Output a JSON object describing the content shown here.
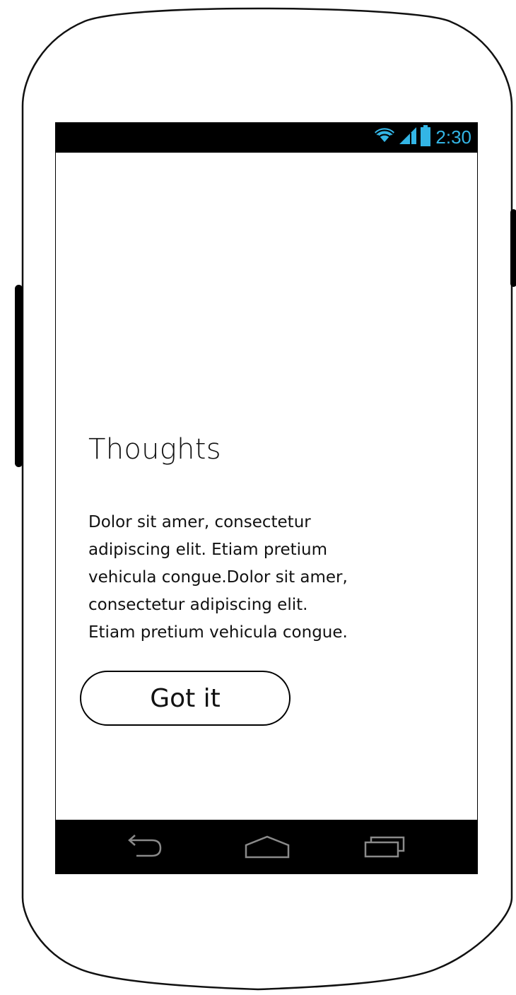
{
  "status_bar": {
    "time": "2:30",
    "icons": [
      "wifi-icon",
      "signal-icon",
      "battery-icon"
    ],
    "accent_color": "#33b5e5"
  },
  "content": {
    "title": "Thoughts",
    "body_lines": [
      "Dolor sit amer, consectetur",
      "adipiscing elit. Etiam pretium",
      "vehicula congue.Dolor sit amer,",
      "consectetur adipiscing elit.",
      "Etiam pretium vehicula congue."
    ],
    "button_label": "Got it"
  },
  "nav_bar": {
    "buttons": [
      "back-icon",
      "home-icon",
      "recent-apps-icon"
    ]
  }
}
